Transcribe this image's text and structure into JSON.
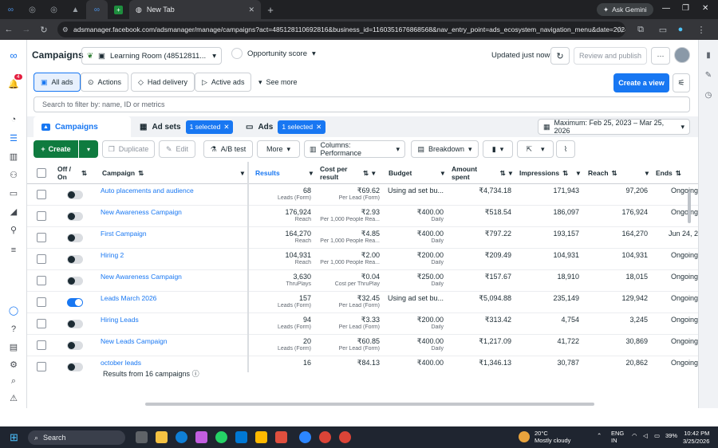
{
  "browser": {
    "tab_title": "New Tab",
    "ask_gemini": "Ask Gemini",
    "url": "adsmanager.facebook.com/adsmanager/manage/campaigns?act=485128110692816&business_id=1160351676868568&nav_entry_point=ads_ecosystem_navigation_menu&date=2024-..."
  },
  "header": {
    "title": "Campaigns",
    "account": "Learning Room (48512811...",
    "opportunity": "Opportunity score",
    "updated": "Updated just now",
    "review": "Review and publish"
  },
  "notifications": {
    "count": "4"
  },
  "filters": {
    "all_ads": "All ads",
    "actions": "Actions",
    "had_delivery": "Had delivery",
    "active_ads": "Active ads",
    "see_more": "See more",
    "create_view": "Create a view",
    "search_placeholder": "Search to filter by: name, ID or metrics"
  },
  "levels": {
    "campaigns": "Campaigns",
    "adsets": "Ad sets",
    "adsets_sel": "1 selected",
    "ads": "Ads",
    "ads_sel": "1 selected",
    "date_range": "Maximum: Feb 25, 2023 – Mar 25, 2026"
  },
  "toolbar": {
    "create": "Create",
    "duplicate": "Duplicate",
    "edit": "Edit",
    "ab_test": "A/B test",
    "more": "More",
    "columns": "Columns: Performance",
    "breakdown": "Breakdown"
  },
  "columns": {
    "off_on": "Off / On",
    "campaign": "Campaign",
    "results": "Results",
    "cost": "Cost per result",
    "budget": "Budget",
    "amount": "Amount spent",
    "impressions": "Impressions",
    "reach": "Reach",
    "ends": "Ends"
  },
  "rows": [
    {
      "name": "Auto placements and audience",
      "on": false,
      "results": "68",
      "results_sub": "Leads (Form)",
      "cost": "₹69.62",
      "cost_sub": "Per Lead (Form)",
      "budget": "Using ad set bu...",
      "budget_sub": "",
      "amount": "₹4,734.18",
      "impressions": "171,943",
      "reach": "97,206",
      "ends": "Ongoing"
    },
    {
      "name": "New Awareness Campaign",
      "on": false,
      "results": "176,924",
      "results_sub": "Reach",
      "cost": "₹2.93",
      "cost_sub": "Per 1,000 People Rea...",
      "budget": "₹400.00",
      "budget_sub": "Daily",
      "amount": "₹518.54",
      "impressions": "186,097",
      "reach": "176,924",
      "ends": "Ongoing"
    },
    {
      "name": "First Campaign",
      "on": false,
      "results": "164,270",
      "results_sub": "Reach",
      "cost": "₹4.85",
      "cost_sub": "Per 1,000 People Rea...",
      "budget": "₹400.00",
      "budget_sub": "Daily",
      "amount": "₹797.22",
      "impressions": "193,157",
      "reach": "164,270",
      "ends": "Jun 24, 2"
    },
    {
      "name": "Hiring 2",
      "on": false,
      "results": "104,931",
      "results_sub": "Reach",
      "cost": "₹2.00",
      "cost_sub": "Per 1,000 People Rea...",
      "budget": "₹200.00",
      "budget_sub": "Daily",
      "amount": "₹209.49",
      "impressions": "104,931",
      "reach": "104,931",
      "ends": "Ongoing"
    },
    {
      "name": "New Awareness Campaign",
      "on": false,
      "results": "3,630",
      "results_sub": "ThruPlays",
      "cost": "₹0.04",
      "cost_sub": "Cost per ThruPlay",
      "budget": "₹250.00",
      "budget_sub": "Daily",
      "amount": "₹157.67",
      "impressions": "18,910",
      "reach": "18,015",
      "ends": "Ongoing"
    },
    {
      "name": "Leads March 2026",
      "on": true,
      "results": "157",
      "results_sub": "Leads (Form)",
      "cost": "₹32.45",
      "cost_sub": "Per Lead (Form)",
      "budget": "Using ad set bu...",
      "budget_sub": "",
      "amount": "₹5,094.88",
      "impressions": "235,149",
      "reach": "129,942",
      "ends": "Ongoing"
    },
    {
      "name": "Hiring Leads",
      "on": false,
      "results": "94",
      "results_sub": "Leads (Form)",
      "cost": "₹3.33",
      "cost_sub": "Per Lead (Form)",
      "budget": "₹200.00",
      "budget_sub": "Daily",
      "amount": "₹313.42",
      "impressions": "4,754",
      "reach": "3,245",
      "ends": "Ongoing"
    },
    {
      "name": "New Leads Campaign",
      "on": false,
      "results": "20",
      "results_sub": "Leads (Form)",
      "cost": "₹60.85",
      "cost_sub": "Per Lead (Form)",
      "budget": "₹400.00",
      "budget_sub": "Daily",
      "amount": "₹1,217.09",
      "impressions": "41,722",
      "reach": "30,869",
      "ends": "Ongoing"
    },
    {
      "name": "october leads",
      "on": false,
      "results": "16",
      "results_sub": "",
      "cost": "₹84.13",
      "cost_sub": "",
      "budget": "₹400.00",
      "budget_sub": "",
      "amount": "₹1,346.13",
      "impressions": "30,787",
      "reach": "20,862",
      "ends": "Ongoing"
    }
  ],
  "footer": {
    "summary": "Results from 16 campaigns"
  },
  "taskbar": {
    "search": "Search",
    "temp": "20°C",
    "weather": "Mostly cloudy",
    "lang1": "ENG",
    "lang2": "IN",
    "battery": "39%",
    "time": "10:42 PM",
    "date": "3/25/2026"
  }
}
